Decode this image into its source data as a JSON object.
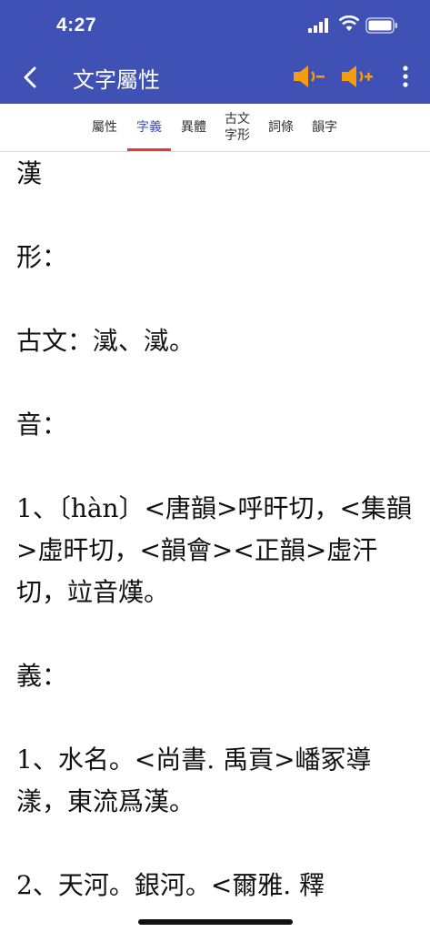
{
  "status": {
    "time": "4:27"
  },
  "appbar": {
    "title": "文字屬性"
  },
  "tabs": [
    {
      "label": "屬性"
    },
    {
      "label": "字義"
    },
    {
      "label": "異體"
    },
    {
      "label_line1": "古文",
      "label_line2": "字形"
    },
    {
      "label": "詞條"
    },
    {
      "label": "韻字"
    }
  ],
  "active_tab": "字義",
  "colors": {
    "appbar": "#3f51b5",
    "speaker": "#f59b0c",
    "tab_active": "#3f51b5",
    "tab_underline": "#e53935"
  },
  "icons": [
    "back-arrow-icon",
    "speaker-minus-icon",
    "speaker-plus-icon",
    "more-vert-icon",
    "signal-icon",
    "wifi-icon",
    "battery-icon"
  ],
  "content": {
    "char": "漢",
    "shape_label": "形：",
    "guwen": "古文：㵄、㵄。",
    "sound_label": "音：",
    "sound_1": "1、〔hàn〕<唐韻>呼旰切，<集韻>虛旰切，<韻會><正韻>虛汗切，竝音熯。",
    "meaning_label": "義：",
    "meaning_1": "1、水名。<尚書. 禹貢>嶓冢導漾，東流爲漢。",
    "meaning_2": "2、天河。銀河。<爾雅. 釋"
  }
}
